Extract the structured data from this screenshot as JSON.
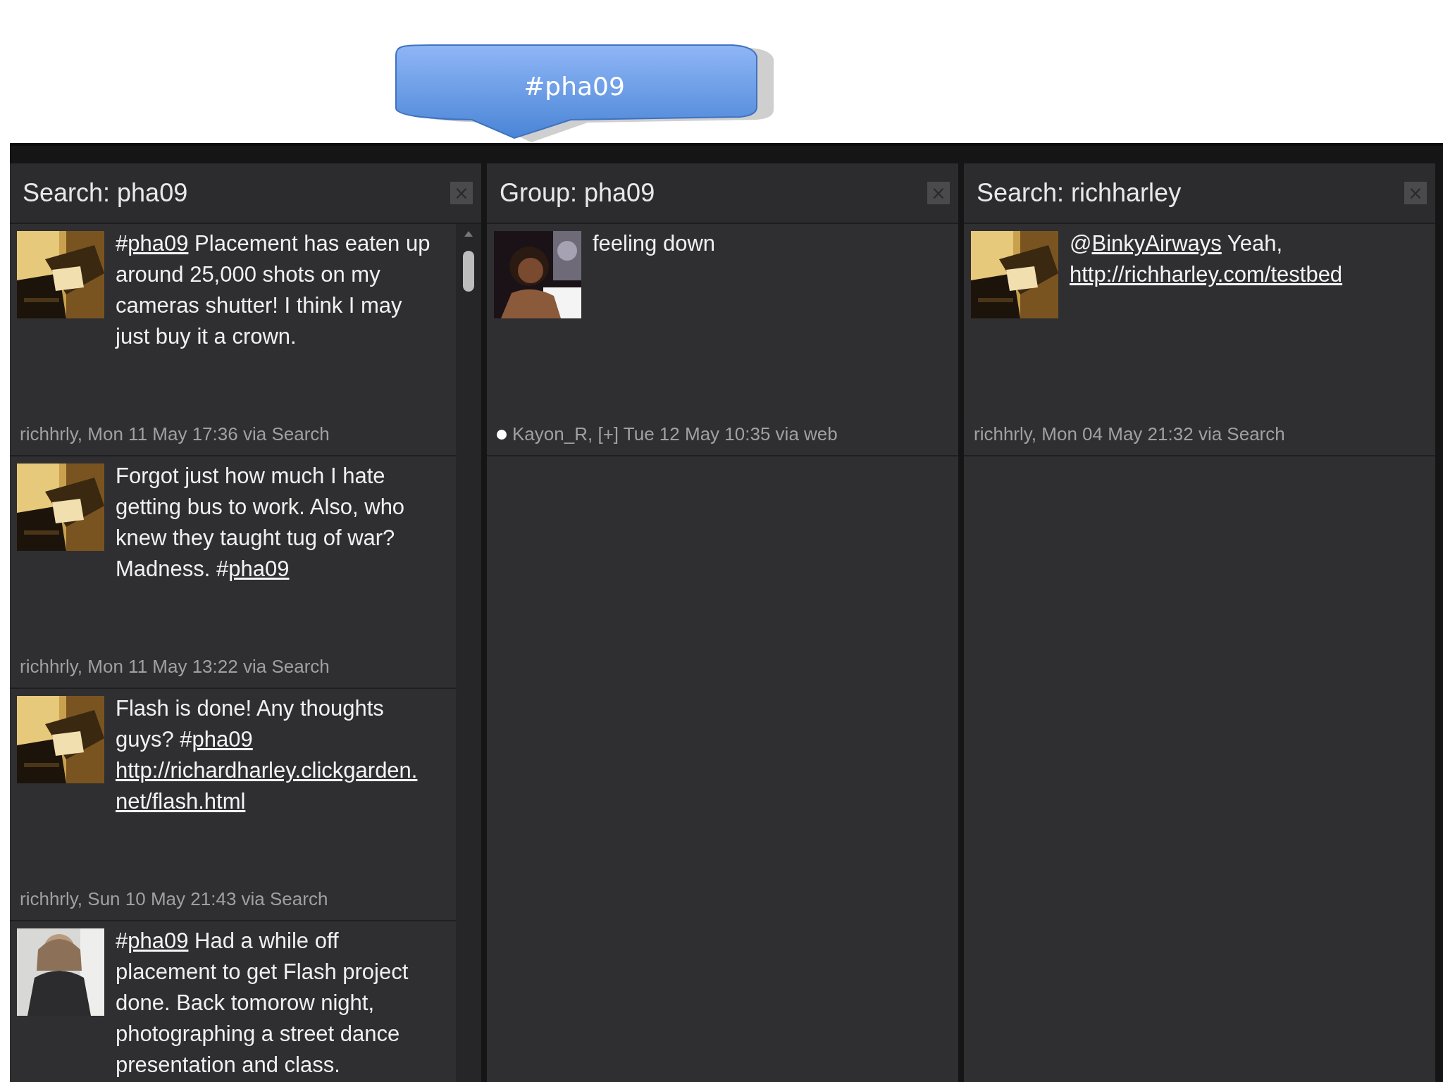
{
  "callout": {
    "text": "#pha09"
  },
  "columns": [
    {
      "title": "Search: pha09",
      "close": "×",
      "scrollable": true,
      "tweets": [
        {
          "lines": [
            [
              {
                "text": "#"
              },
              {
                "text": "pha09",
                "link": true
              },
              {
                "text": " Placement has eaten up"
              }
            ],
            [
              {
                "text": "around 25,000 shots on my"
              }
            ],
            [
              {
                "text": "cameras shutter! I think I may"
              }
            ],
            [
              {
                "text": "just buy it a crown."
              }
            ]
          ],
          "meta": "richhrly, Mon 11 May 17:36 via Search"
        },
        {
          "lines": [
            [
              {
                "text": "Forgot just how much I hate"
              }
            ],
            [
              {
                "text": "getting bus to work. Also, who"
              }
            ],
            [
              {
                "text": "knew they taught tug of war?"
              }
            ],
            [
              {
                "text": "Madness. #"
              },
              {
                "text": "pha09",
                "link": true
              }
            ]
          ],
          "meta": "richhrly, Mon 11 May 13:22 via Search"
        },
        {
          "lines": [
            [
              {
                "text": "Flash is done! Any thoughts"
              }
            ],
            [
              {
                "text": "guys? #"
              },
              {
                "text": "pha09",
                "link": true
              }
            ],
            [
              {
                "text": "http://richardharley.clickgarden.",
                "link": true
              }
            ],
            [
              {
                "text": "net/flash.html",
                "link": true
              }
            ]
          ],
          "meta": "richhrly, Sun 10 May 21:43 via Search"
        },
        {
          "lines": [
            [
              {
                "text": "#"
              },
              {
                "text": "pha09",
                "link": true
              },
              {
                "text": " Had a while off"
              }
            ],
            [
              {
                "text": "placement to get Flash project"
              }
            ],
            [
              {
                "text": "done. Back tomorow night,"
              }
            ],
            [
              {
                "text": "photographing a street dance"
              }
            ],
            [
              {
                "text": "presentation and class."
              }
            ]
          ]
        }
      ]
    },
    {
      "title": "Group: pha09",
      "close": "×",
      "scrollable": false,
      "tweets": [
        {
          "lines": [
            [
              {
                "text": "feeling down"
              }
            ]
          ],
          "dot": true,
          "meta": "Kayon_R, [+] Tue 12 May 10:35 via web"
        }
      ]
    },
    {
      "title": "Search: richharley",
      "close": "×",
      "scrollable": false,
      "tweets": [
        {
          "lines": [
            [
              {
                "text": "@"
              },
              {
                "text": "BinkyAirways",
                "link": true
              },
              {
                "text": " Yeah,"
              }
            ],
            [
              {
                "text": "http://richharley.com/testbed",
                "link": true
              }
            ]
          ],
          "meta": "richhrly, Mon 04 May 21:32 via Search"
        }
      ]
    }
  ]
}
